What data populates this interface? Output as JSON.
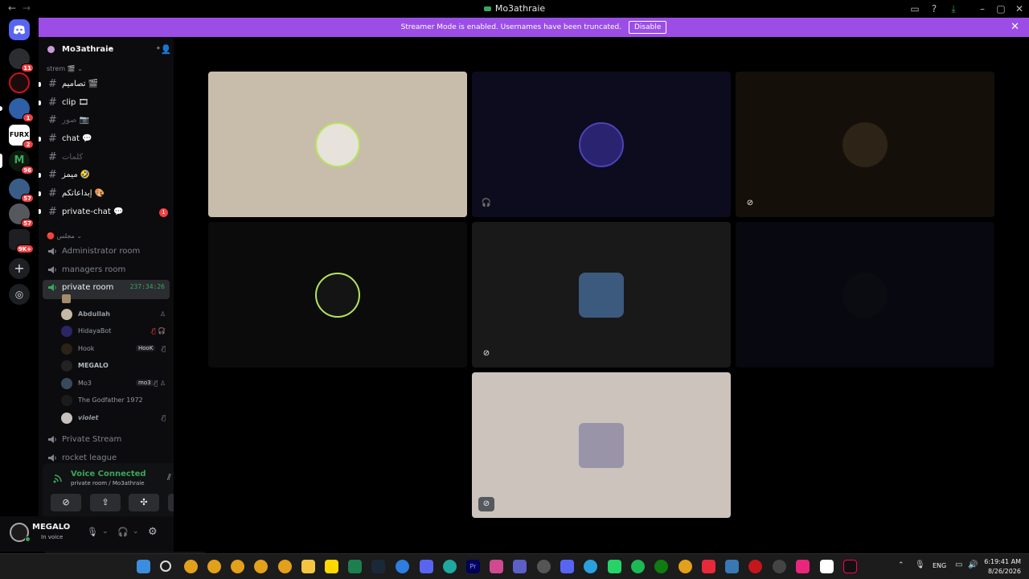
{
  "window": {
    "title": "Mo3athraie",
    "nav_back": "←",
    "nav_forward": "→"
  },
  "banner": {
    "text": "Streamer Mode is enabled. Usernames have been truncated.",
    "disable_label": "Disable",
    "close": "✕"
  },
  "server": {
    "name": "Mo3athraie",
    "rail_badges": [
      "11",
      "1",
      "2",
      "96",
      "57",
      "57",
      "9K+"
    ],
    "categories": {
      "streams": "strem 🎬",
      "council": "مجلس"
    },
    "text_channels": [
      {
        "name": "تصاميم 🎬"
      },
      {
        "name": "clip 🎞"
      },
      {
        "name": "صور 📷"
      },
      {
        "name": "chat 💬"
      },
      {
        "name": "كلمات"
      },
      {
        "name": "ميمز 🤣"
      },
      {
        "name": "إبداعاتكم 🎨"
      },
      {
        "name": "private-chat 💬",
        "badge": "1"
      }
    ],
    "voice_channels": [
      {
        "name": "Administrator room"
      },
      {
        "name": "managers room"
      },
      {
        "name": "private room",
        "timer": "237:34:26"
      },
      {
        "name": "Private Stream"
      },
      {
        "name": "rocket league"
      }
    ],
    "members": [
      {
        "name": "Abdullah",
        "tag": "",
        "icons": "♙"
      },
      {
        "name": "HidayaBot",
        "tag": "",
        "icons": "🎙̸ 🎧̸"
      },
      {
        "name": "Hook",
        "tag": "HooK",
        "icons": "🎙̸"
      },
      {
        "name": "MEGALO",
        "tag": "",
        "icons": ""
      },
      {
        "name": "Mo3",
        "tag": "mo3",
        "icons": "🎙̸ ♙"
      },
      {
        "name": "The Godfather 1972",
        "tag": "",
        "icons": ""
      },
      {
        "name": "violet",
        "tag": "",
        "icons": "🎙̸"
      }
    ]
  },
  "voice_panel": {
    "status": "Voice Connected",
    "location": "private room / Mo3athraie"
  },
  "user": {
    "name": "MEGALO",
    "status": "In voice"
  },
  "taskbar": {
    "language": "ENG",
    "time": "6:19:41 AM",
    "date": "8/26/2026"
  },
  "colors": {
    "banner": "#9b4de6",
    "voice_green": "#3ba55d",
    "mention_red": "#f23f43"
  }
}
